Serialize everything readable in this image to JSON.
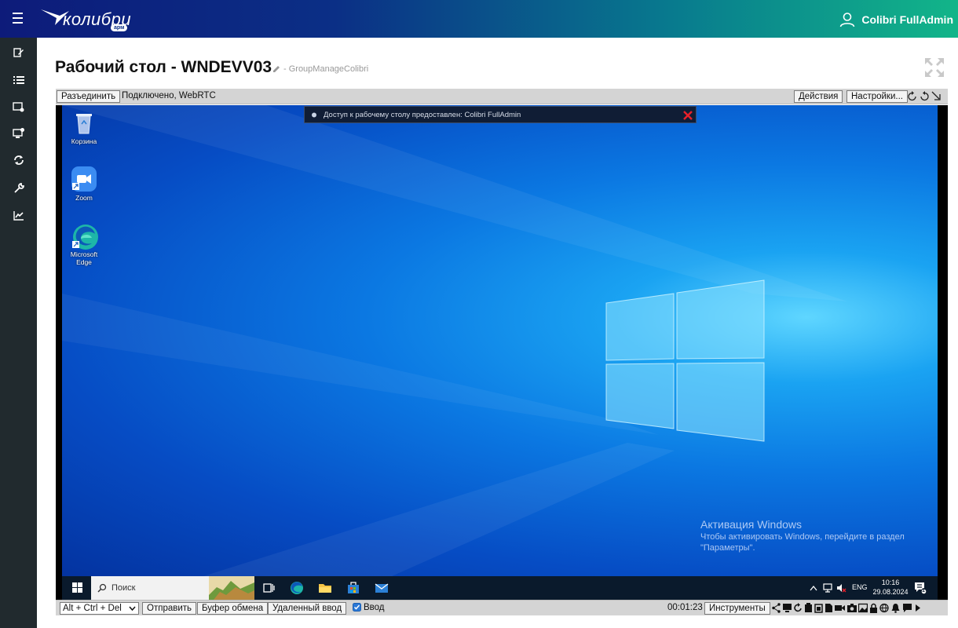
{
  "header": {
    "logo_text": "колибри",
    "logo_badge": "арм",
    "user_name": "Colibri FullAdmin"
  },
  "sidebar": {
    "items": [
      "edit-icon",
      "list-icon",
      "computer-settings-icon",
      "monitor-add-icon",
      "refresh-icon",
      "wrench-icon",
      "chart-icon"
    ]
  },
  "page": {
    "title": "Рабочий стол - WNDEVV03",
    "group": "- GroupManageColibri"
  },
  "toolbar_top": {
    "disconnect": "Разъединить",
    "status": "Подключено, WebRTC",
    "actions": "Действия",
    "settings": "Настройки..."
  },
  "desktop": {
    "notification": "Доступ к рабочему столу предоставлен: Colibri FullAdmin",
    "icons": [
      {
        "label": "Корзина"
      },
      {
        "label": "Zoom"
      },
      {
        "label": "Microsoft Edge"
      }
    ],
    "activation_title": "Активация Windows",
    "activation_line1": "Чтобы активировать Windows, перейдите в раздел",
    "activation_line2": "\"Параметры\"."
  },
  "taskbar": {
    "search_placeholder": "Поиск",
    "lang": "ENG",
    "time": "10:16",
    "date": "29.08.2024",
    "notifications_count": "1"
  },
  "toolbar_bottom": {
    "key_combo": "Alt + Ctrl + Del",
    "send": "Отправить",
    "clipboard": "Буфер обмена",
    "remote_input": "Удаленный ввод",
    "input_label": "Ввод",
    "input_checked": true,
    "timer": "00:01:23",
    "tools": "Инструменты"
  },
  "colors": {
    "header_start": "#0d1b7a",
    "header_end": "#12b589",
    "sidebar": "#212a2e",
    "desktop_blue": "#0b78e2"
  }
}
